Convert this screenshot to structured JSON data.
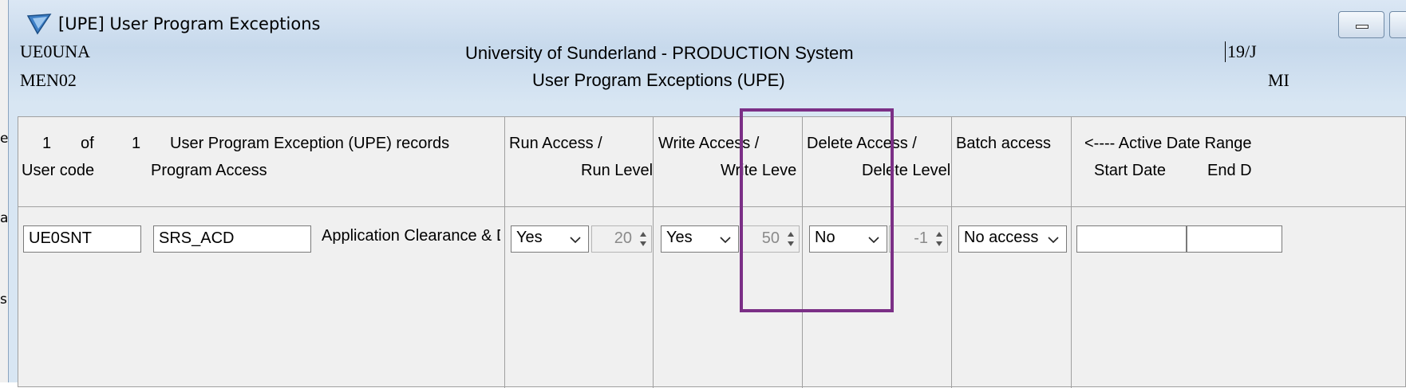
{
  "behind_window": {
    "fragments": [
      "e",
      "ar",
      "s"
    ]
  },
  "window": {
    "title": "[UPE] User Program Exceptions",
    "icon": "arrow-logo-icon",
    "minimize_icon": "minimize-icon",
    "maximize_icon": "maximize-icon"
  },
  "header": {
    "user_id": "UE0UNA",
    "menu_id": "MEN02",
    "system_title": "University of Sunderland - PRODUCTION System",
    "screen_title": "User Program Exceptions (UPE)",
    "date_fragment": "19/J",
    "right_fragment": "MI"
  },
  "columns": {
    "record_index": "1",
    "of_label": "of",
    "record_total": "1",
    "records_label": "User Program Exception (UPE) records",
    "user_code": "User code",
    "program_access": "Program Access",
    "run_access": "Run Access /",
    "run_level": "Run Level",
    "write_access": "Write Access /",
    "write_level": "Write Leve",
    "delete_access": "Delete Access /",
    "delete_level": "Delete Level",
    "batch_access": "Batch access",
    "active_date_range": "<---- Active Date Range",
    "start_date": "Start Date",
    "end_date": "End D"
  },
  "row": {
    "user_code": "UE0SNT",
    "program_code": "SRS_ACD",
    "program_desc": "Application Clearance & D",
    "run_access": "Yes",
    "run_level": "20",
    "write_access": "Yes",
    "write_level": "50",
    "delete_access": "No",
    "delete_level": "-1",
    "batch_access": "No access",
    "start_date": "",
    "end_date": ""
  },
  "colors": {
    "highlight_border": "#7b2f86",
    "panel_bg": "#f0f0f0",
    "title_gradient_top": "#dbe7f4"
  }
}
